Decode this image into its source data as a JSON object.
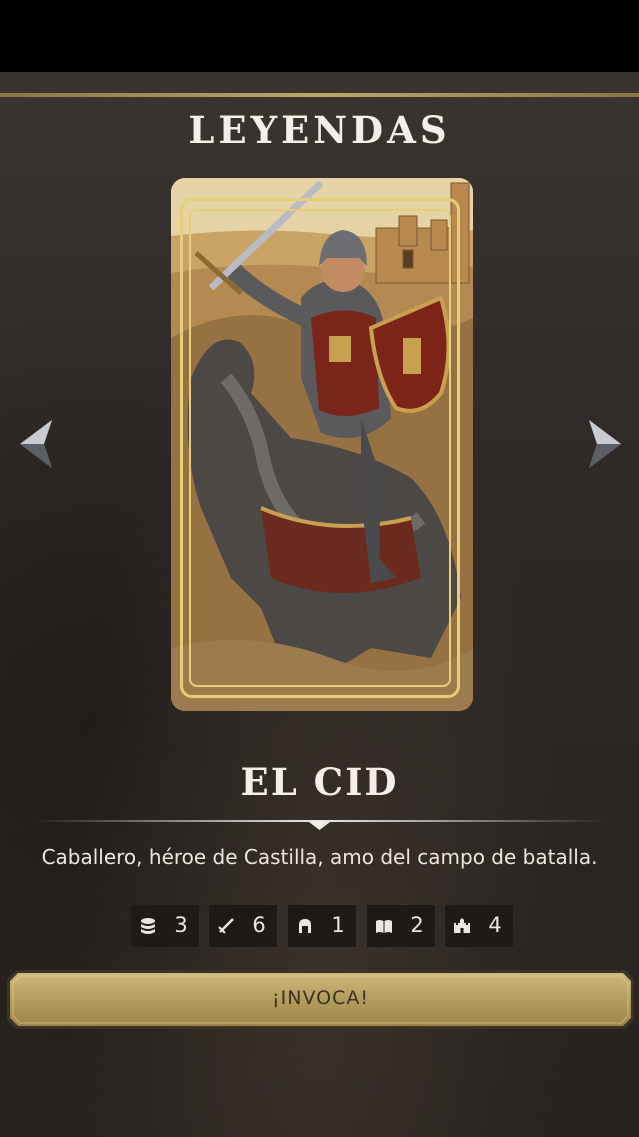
{
  "screen": {
    "title": "LEYENDAS"
  },
  "navigation": {
    "prev_icon": "chevron-left-icon",
    "next_icon": "chevron-right-icon"
  },
  "legend": {
    "name": "EL CID",
    "description": "Caballero, héroe de Castilla, amo del campo de batalla.",
    "stats": [
      {
        "icon": "coins-icon",
        "value": "3"
      },
      {
        "icon": "sword-icon",
        "value": "6"
      },
      {
        "icon": "helmet-icon",
        "value": "1"
      },
      {
        "icon": "book-icon",
        "value": "2"
      },
      {
        "icon": "castle-icon",
        "value": "4"
      }
    ]
  },
  "actions": {
    "invoke_label": "¡INVOCA!"
  },
  "colors": {
    "gold": "#e7cf79",
    "button_gold": "#b9a469",
    "background": "#2f2a27"
  }
}
